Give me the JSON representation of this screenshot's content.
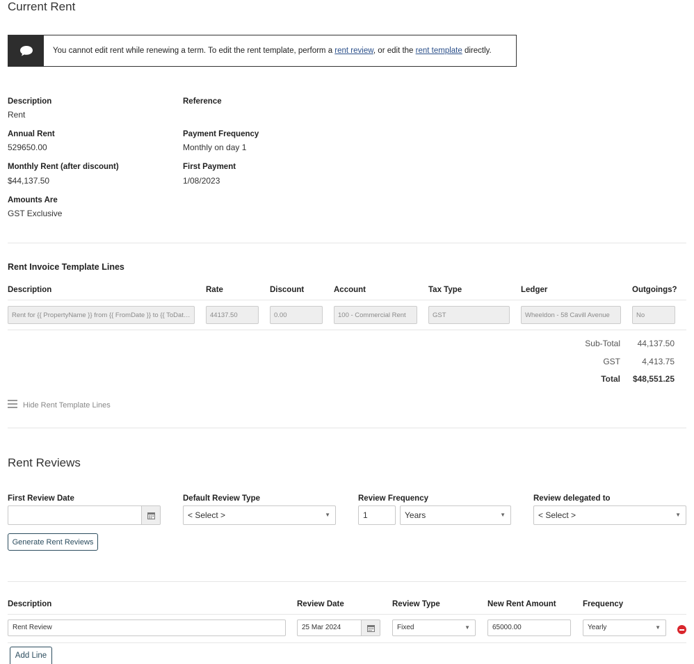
{
  "page_title": "Current Rent",
  "notice": {
    "text_before": "You cannot edit rent while renewing a term. To edit the rent template, perform a ",
    "link1": "rent review",
    "text_middle": ", or edit the ",
    "link2": "rent template",
    "text_after": " directly."
  },
  "details": {
    "description_label": "Description",
    "description_value": "Rent",
    "reference_label": "Reference",
    "annual_rent_label": "Annual Rent",
    "annual_rent_value": "529650.00",
    "payment_frequency_label": "Payment Frequency",
    "payment_frequency_value": "Monthly on day 1",
    "monthly_rent_label": "Monthly Rent (after discount)",
    "monthly_rent_value": "$44,137.50",
    "first_payment_label": "First Payment",
    "first_payment_value": "1/08/2023",
    "amounts_are_label": "Amounts Are",
    "amounts_are_value": "GST Exclusive"
  },
  "template_lines": {
    "heading": "Rent Invoice Template Lines",
    "headers": {
      "description": "Description",
      "rate": "Rate",
      "discount": "Discount",
      "account": "Account",
      "tax_type": "Tax Type",
      "ledger": "Ledger",
      "outgoings": "Outgoings?"
    },
    "row": {
      "description": "Rent for {{ PropertyName }} from {{ FromDate }} to {{ ToDate }}",
      "rate": "44137.50",
      "discount": "0.00",
      "account": "100 - Commercial Rent",
      "tax_type": "GST",
      "ledger": "Wheeldon - 58 Cavill Avenue",
      "outgoings": "No"
    },
    "subtotal_label": "Sub-Total",
    "subtotal_value": "44,137.50",
    "gst_label": "GST",
    "gst_value": "4,413.75",
    "total_label": "Total",
    "total_value": "$48,551.25",
    "hide_label": "Hide Rent Template Lines"
  },
  "rent_reviews": {
    "heading": "Rent Reviews",
    "first_review_date_label": "First Review Date",
    "first_review_date_value": "",
    "default_review_type_label": "Default Review Type",
    "default_review_type_value": "< Select >",
    "review_frequency_label": "Review Frequency",
    "review_frequency_number": "1",
    "review_frequency_unit": "Years",
    "review_delegated_label": "Review delegated to",
    "review_delegated_value": "< Select >",
    "generate_button": "Generate Rent Reviews",
    "table_headers": {
      "description": "Description",
      "review_date": "Review Date",
      "review_type": "Review Type",
      "new_rent_amount": "New Rent Amount",
      "frequency": "Frequency"
    },
    "row": {
      "description": "Rent Review",
      "review_date": "25 Mar 2024",
      "review_type": "Fixed",
      "new_rent_amount": "65000.00",
      "frequency": "Yearly"
    },
    "add_line_button": "Add Line"
  },
  "colors": {
    "notice_icon_bg": "#2d2d2d",
    "link": "#2a4f8a",
    "button_border": "#2b4c5e",
    "remove_icon": "#d9262d"
  }
}
